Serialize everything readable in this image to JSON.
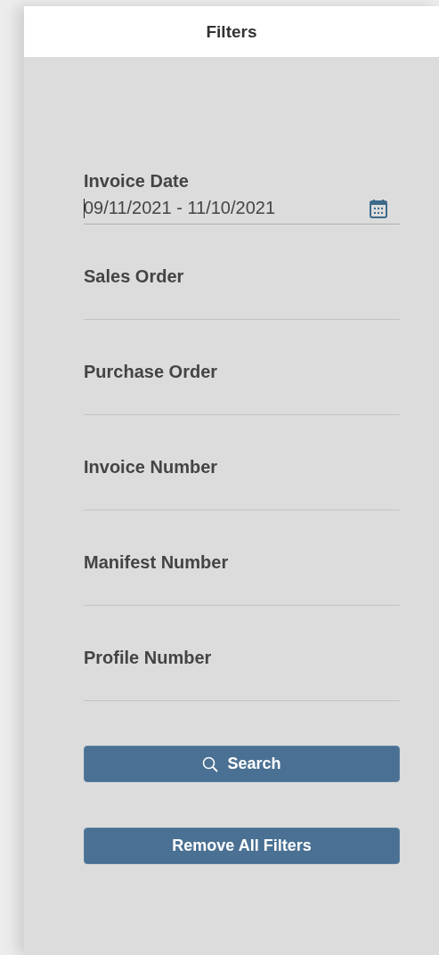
{
  "panel": {
    "title": "Filters"
  },
  "fields": [
    {
      "kind": "date",
      "label": "Invoice Date",
      "value": "09/11/2021 - 11/10/2021",
      "focused": true
    },
    {
      "kind": "text",
      "label": "Sales Order",
      "focused": false
    },
    {
      "kind": "text",
      "label": "Purchase Order",
      "focused": false
    },
    {
      "kind": "text",
      "label": "Invoice Number",
      "focused": false
    },
    {
      "kind": "text",
      "label": "Manifest Number",
      "focused": false
    },
    {
      "kind": "text",
      "label": "Profile Number",
      "focused": false
    }
  ],
  "buttons": [
    {
      "kind": "search",
      "label": "Search"
    },
    {
      "kind": "plain",
      "label": "Remove All Filters"
    }
  ]
}
